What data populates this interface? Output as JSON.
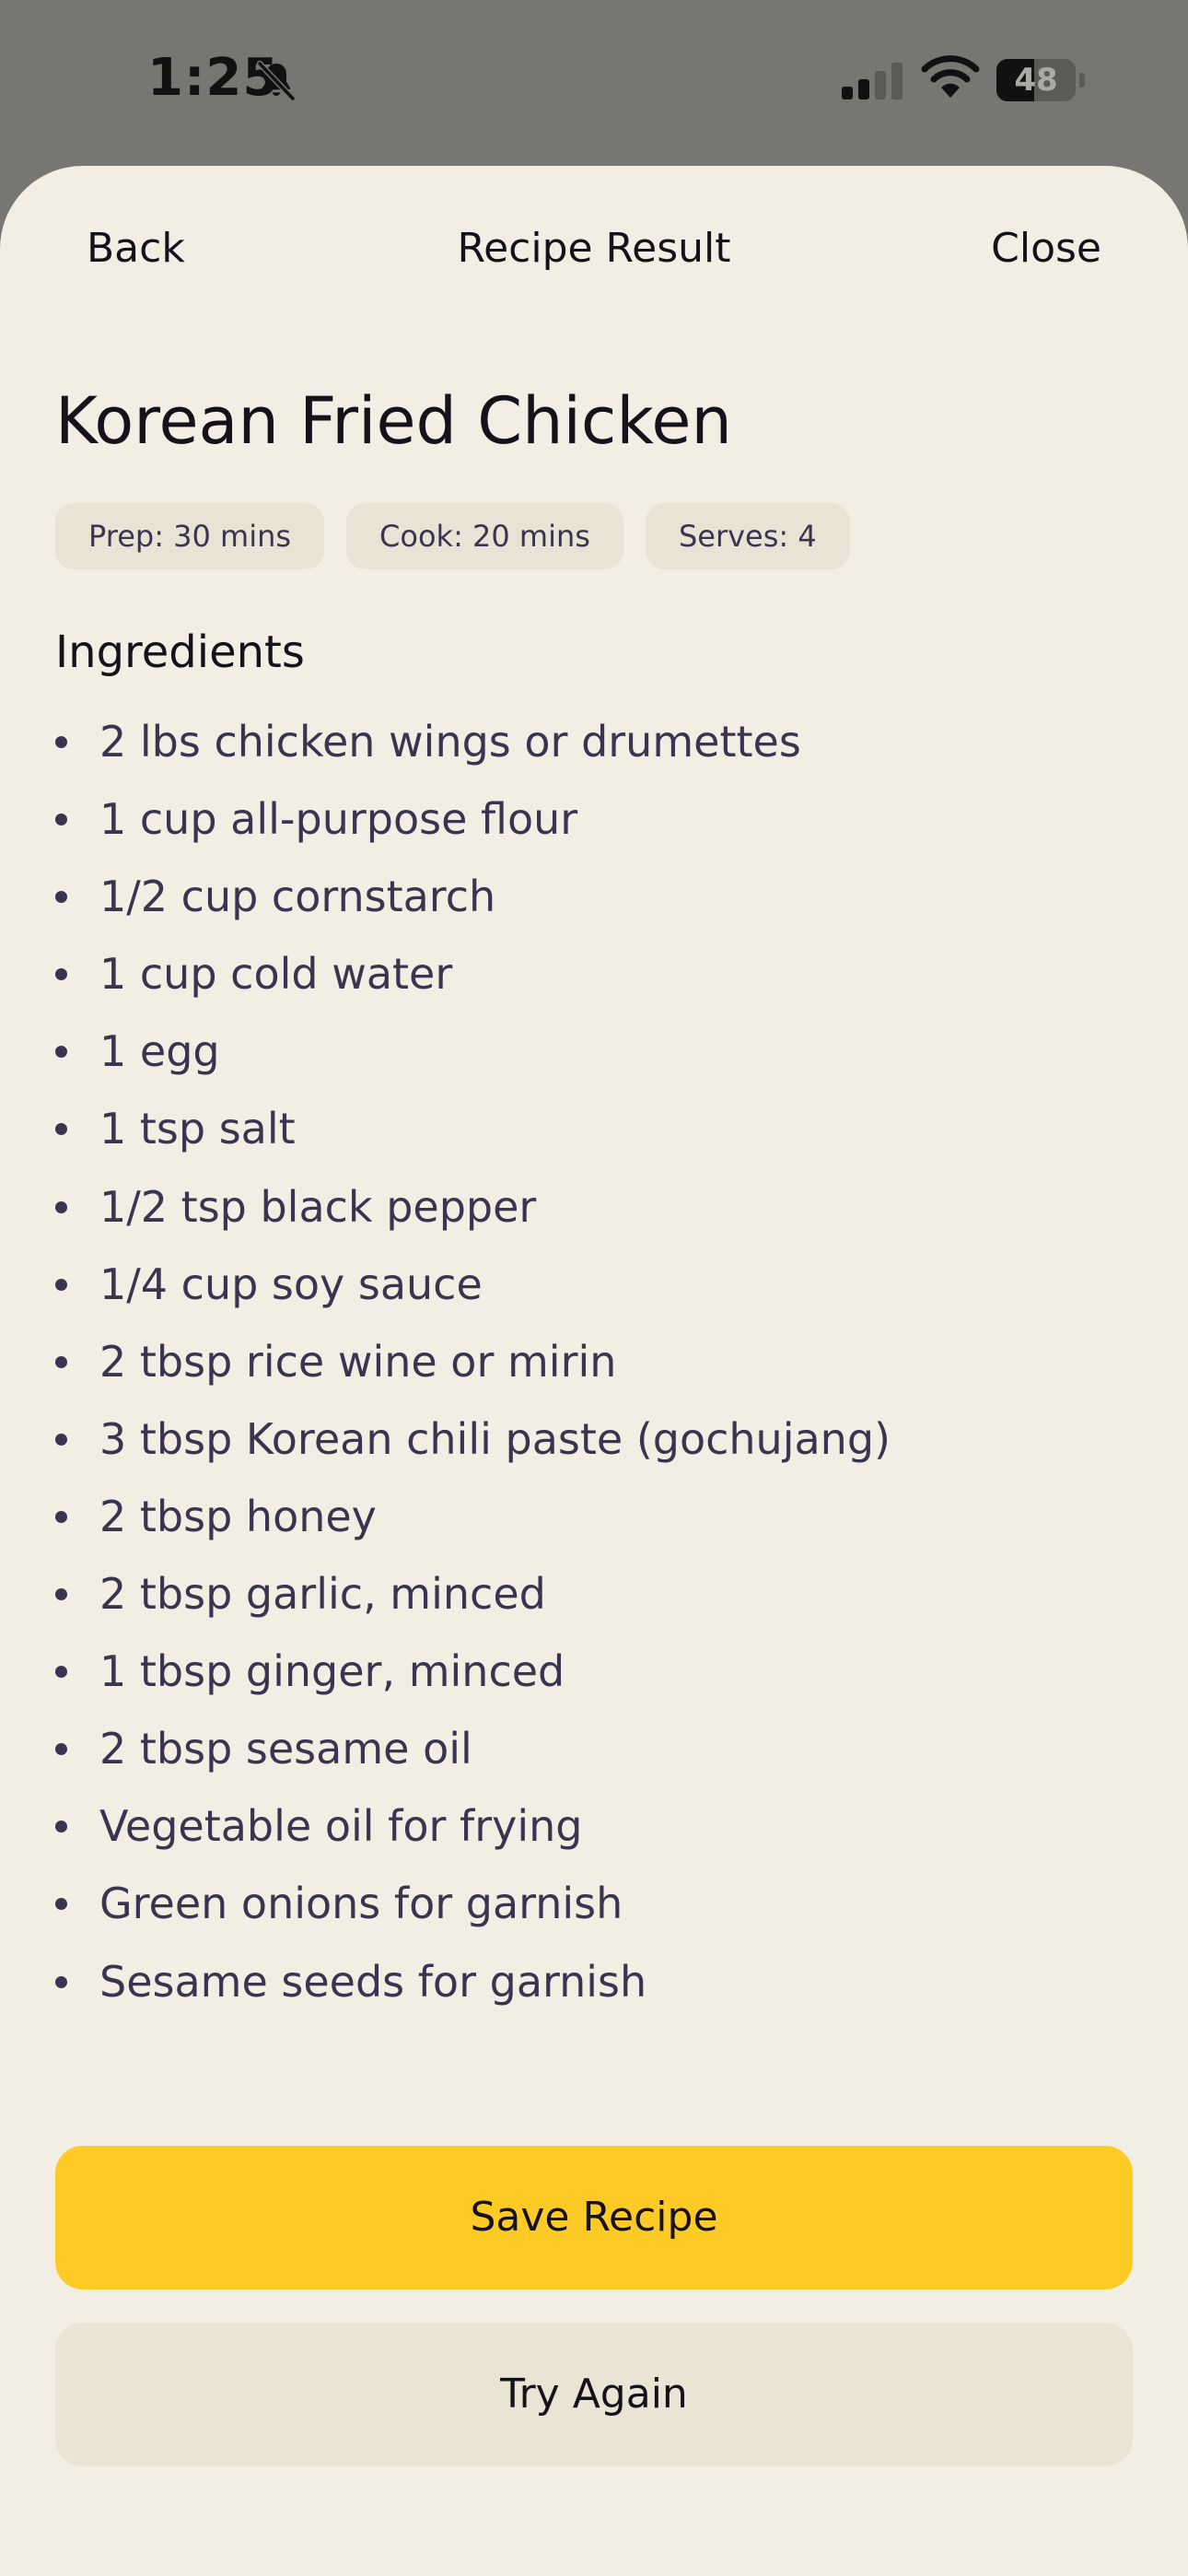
{
  "status_bar": {
    "time": "1:25",
    "battery_level": "48",
    "battery_fraction": 0.48,
    "bell_icon": "bell-slash-icon",
    "signal_icon": "cellular-signal-icon",
    "wifi_icon": "wifi-icon"
  },
  "nav": {
    "back_label": "Back",
    "title": "Recipe Result",
    "close_label": "Close"
  },
  "recipe": {
    "title": "Korean Fried Chicken",
    "meta": {
      "prep": "Prep: 30 mins",
      "cook": "Cook: 20 mins",
      "serves": "Serves: 4"
    },
    "ingredients_heading": "Ingredients",
    "ingredients": [
      "2 lbs chicken wings or drumettes",
      "1 cup all-purpose flour",
      "1/2 cup cornstarch",
      "1 cup cold water",
      "1 egg",
      "1 tsp salt",
      "1/2 tsp black pepper",
      "1/4 cup soy sauce",
      "2 tbsp rice wine or mirin",
      "3 tbsp Korean chili paste (gochujang)",
      "2 tbsp honey",
      "2 tbsp garlic, minced",
      "1 tbsp ginger, minced",
      "2 tbsp sesame oil",
      "Vegetable oil for frying",
      "Green onions for garnish",
      "Sesame seeds for garnish"
    ]
  },
  "actions": {
    "save_label": "Save Recipe",
    "retry_label": "Try Again"
  },
  "colors": {
    "backdrop": "#767672",
    "sheet": "#f2eee3",
    "chip": "#e8e3d4",
    "accent": "#fecb26",
    "secondary_button": "#e9e4d4",
    "text_primary": "#15121c",
    "text_secondary": "#3a3450"
  }
}
